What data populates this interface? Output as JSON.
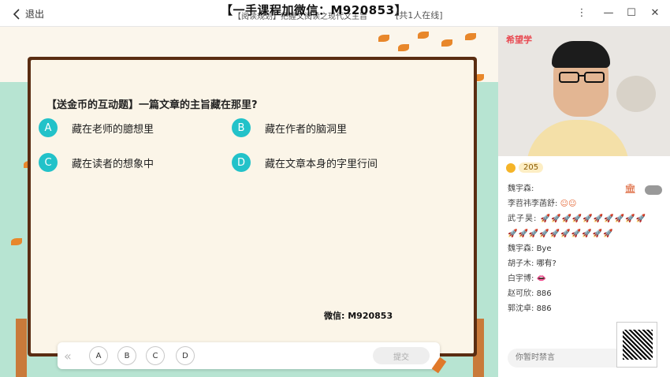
{
  "topbar": {
    "back_label": "退出",
    "title_overlay": "【一手课程加微信：M920853】",
    "title_under": "【阅读规划】把握文阅读之现代文主旨",
    "online": "[共1人在线]"
  },
  "question": {
    "text": "【送金币的互动题】一篇文章的主旨藏在那里?",
    "options": [
      {
        "key": "A",
        "text": "藏在老师的臆想里"
      },
      {
        "key": "B",
        "text": "藏在作者的脑洞里"
      },
      {
        "key": "C",
        "text": "藏在读者的想象中"
      },
      {
        "key": "D",
        "text": "藏在文章本身的字里行间"
      }
    ],
    "watermark": "微信: M920853"
  },
  "answer_bar": {
    "options": [
      "A",
      "B",
      "C",
      "D"
    ],
    "submit": "提交"
  },
  "video": {
    "brand": "希望学"
  },
  "coins": {
    "count": "205"
  },
  "chat": {
    "messages": [
      {
        "name": "魏宇森:",
        "text": ""
      },
      {
        "name": "李苕祎李菡舒:",
        "text": "☺☺"
      },
      {
        "name": "武子昊:",
        "text": "🚀🚀🚀🚀🚀🚀🚀🚀🚀🚀"
      },
      {
        "name": "",
        "text": "🚀🚀🚀🚀🚀🚀🚀🚀🚀🚀"
      },
      {
        "name": "魏宇森:",
        "text": "Bye"
      },
      {
        "name": "胡子木:",
        "text": "哪有?"
      },
      {
        "name": "白宇博:",
        "text": "👄"
      },
      {
        "name": "赵可欣:",
        "text": "886"
      },
      {
        "name": "郭沈卓:",
        "text": "886"
      }
    ],
    "input_placeholder": "你暂时禁言"
  },
  "colors": {
    "accent": "#22c2c9",
    "board_frame": "#5a2d12",
    "brand": "#e9474f"
  }
}
